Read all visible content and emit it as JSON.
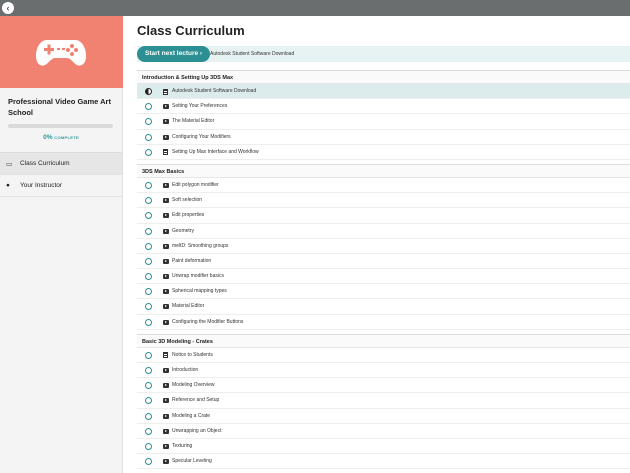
{
  "topbar": {
    "back_icon": "back-arrow-icon",
    "back_glyph": "‹"
  },
  "sidebar": {
    "hero_color": "#f18272",
    "hero_icon": "gamepad-icon",
    "course_title": "Professional Video Game Art School",
    "progress": {
      "percent": 0,
      "label": "0%",
      "label_suffix": "COMPLETE"
    },
    "nav": [
      {
        "label": "Class Curriculum",
        "icon": "curriculum-icon",
        "glyph": "▭"
      },
      {
        "label": "Your Instructor",
        "icon": "user-icon",
        "glyph": "●"
      }
    ]
  },
  "main": {
    "title": "Class Curriculum",
    "start_button": "Start next lecture  ›",
    "next_lecture": "Autodesk Student Software Download",
    "accent_color": "#2c8f93"
  },
  "sections": [
    {
      "title": "Introduction & Setting Up 3DS Max",
      "lectures": [
        {
          "title": "Autodesk Student Software Download",
          "type": "doc",
          "state": "current"
        },
        {
          "title": "Setting Your Preferences",
          "type": "video",
          "state": "todo"
        },
        {
          "title": "The Material Editor",
          "type": "video",
          "state": "todo"
        },
        {
          "title": "Configuring Your Modifiers",
          "type": "video",
          "state": "todo"
        },
        {
          "title": "Setting Up Max Interface and Workflow",
          "type": "doc",
          "state": "todo"
        }
      ]
    },
    {
      "title": "3DS Max Basics",
      "lectures": [
        {
          "title": "Edit polygon modifier",
          "type": "video",
          "state": "todo"
        },
        {
          "title": "Soft selection",
          "type": "video",
          "state": "todo"
        },
        {
          "title": "Edit properties",
          "type": "video",
          "state": "todo"
        },
        {
          "title": "Geometry",
          "type": "video",
          "state": "todo"
        },
        {
          "title": "meltD: Smoothing groups",
          "type": "video",
          "state": "todo"
        },
        {
          "title": "Paint deformation",
          "type": "video",
          "state": "todo"
        },
        {
          "title": "Unwrap modifier basics",
          "type": "video",
          "state": "todo"
        },
        {
          "title": "Spherical mapping types",
          "type": "video",
          "state": "todo"
        },
        {
          "title": "Material Editor",
          "type": "video",
          "state": "todo"
        },
        {
          "title": "Configuring the Modifier Buttons",
          "type": "video",
          "state": "todo"
        }
      ]
    },
    {
      "title": "Basic 3D Modeling - Crates",
      "lectures": [
        {
          "title": "Notice to Students",
          "type": "doc",
          "state": "todo"
        },
        {
          "title": "Introduction",
          "type": "video",
          "state": "todo"
        },
        {
          "title": "Modeling Overview",
          "type": "video",
          "state": "todo"
        },
        {
          "title": "Reference and Setup",
          "type": "video",
          "state": "todo"
        },
        {
          "title": "Modeling a Crate",
          "type": "video",
          "state": "todo"
        },
        {
          "title": "Unwrapping an Object",
          "type": "video",
          "state": "todo"
        },
        {
          "title": "Texturing",
          "type": "video",
          "state": "todo"
        },
        {
          "title": "Specular Leveling",
          "type": "video",
          "state": "todo"
        }
      ]
    }
  ]
}
